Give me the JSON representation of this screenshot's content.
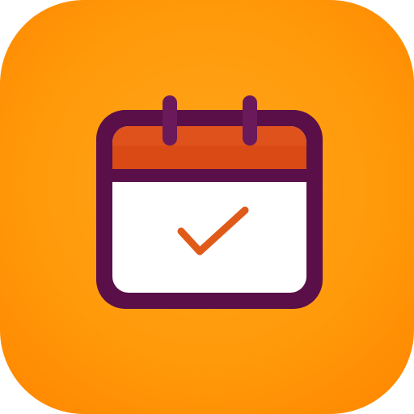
{
  "app_icon": {
    "glyph": "calendar-check-icon",
    "colors": {
      "background_light": "#ffa51a",
      "background_mid": "#ff9a0a",
      "background_dark": "#ff8800",
      "outline": "#5a0f48",
      "header": "#d94a14",
      "header_highlight": "#e35a22",
      "page": "#ffffff",
      "ring": "#6a1a5a",
      "checkmark": "#e05a1a"
    }
  }
}
